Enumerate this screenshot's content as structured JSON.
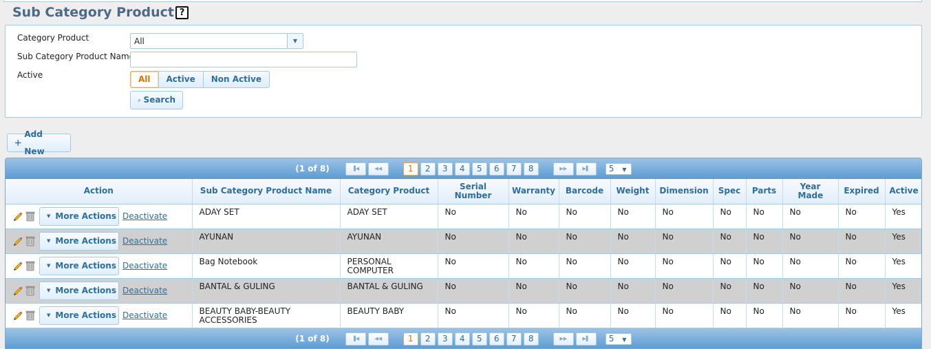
{
  "page": {
    "title": "Sub Category Product",
    "help_glyph": "?"
  },
  "filter": {
    "category_label": "Category Product",
    "category_value": "All",
    "subcategory_label": "Sub Category Product Name",
    "subcategory_value": "",
    "active_label": "Active",
    "active_options": [
      "All",
      "Active",
      "Non Active"
    ],
    "active_selected": "All",
    "search_label": "Search"
  },
  "toolbar": {
    "add_new_label": "Add New"
  },
  "pagination": {
    "info": "(1 of 8)",
    "pages": [
      "1",
      "2",
      "3",
      "4",
      "5",
      "6",
      "7",
      "8"
    ],
    "current_page": "1",
    "rows_per_page": "5"
  },
  "table": {
    "columns": [
      "Action",
      "Sub Category Product Name",
      "Category Product",
      "Serial Number",
      "Warranty",
      "Barcode",
      "Weight",
      "Dimension",
      "Spec",
      "Parts",
      "Year Made",
      "Expired",
      "Active"
    ],
    "more_actions_label": "More Actions",
    "deactivate_label": "Deactivate",
    "rows": [
      {
        "name": "ADAY SET",
        "category": "ADAY SET",
        "serial": "No",
        "warranty": "No",
        "barcode": "No",
        "weight": "No",
        "dimension": "No",
        "spec": "No",
        "parts": "No",
        "year_made": "No",
        "expired": "No",
        "active": "Yes"
      },
      {
        "name": "AYUNAN",
        "category": "AYUNAN",
        "serial": "No",
        "warranty": "No",
        "barcode": "No",
        "weight": "No",
        "dimension": "No",
        "spec": "No",
        "parts": "No",
        "year_made": "No",
        "expired": "No",
        "active": "Yes"
      },
      {
        "name": "Bag Notebook",
        "category": "PERSONAL COMPUTER",
        "serial": "No",
        "warranty": "No",
        "barcode": "No",
        "weight": "No",
        "dimension": "No",
        "spec": "No",
        "parts": "No",
        "year_made": "No",
        "expired": "No",
        "active": "Yes"
      },
      {
        "name": "BANTAL & GULING",
        "category": "BANTAL & GULING",
        "serial": "No",
        "warranty": "No",
        "barcode": "No",
        "weight": "No",
        "dimension": "No",
        "spec": "No",
        "parts": "No",
        "year_made": "No",
        "expired": "No",
        "active": "Yes"
      },
      {
        "name": "BEAUTY BABY-BEAUTY ACCESSORIES",
        "category": "BEAUTY BABY",
        "serial": "No",
        "warranty": "No",
        "barcode": "No",
        "weight": "No",
        "dimension": "No",
        "spec": "No",
        "parts": "No",
        "year_made": "No",
        "expired": "No",
        "active": "Yes"
      }
    ]
  },
  "icons": {
    "edit": "pencil-icon",
    "delete": "trash-icon",
    "search": "magnifier-icon",
    "add": "plus-icon"
  },
  "colors": {
    "title": "#4b6a8a",
    "accent": "#2e6e9e",
    "selected": "#e17009",
    "header_bar": "#5a9bd2",
    "alt_row": "#d0d0d0"
  }
}
